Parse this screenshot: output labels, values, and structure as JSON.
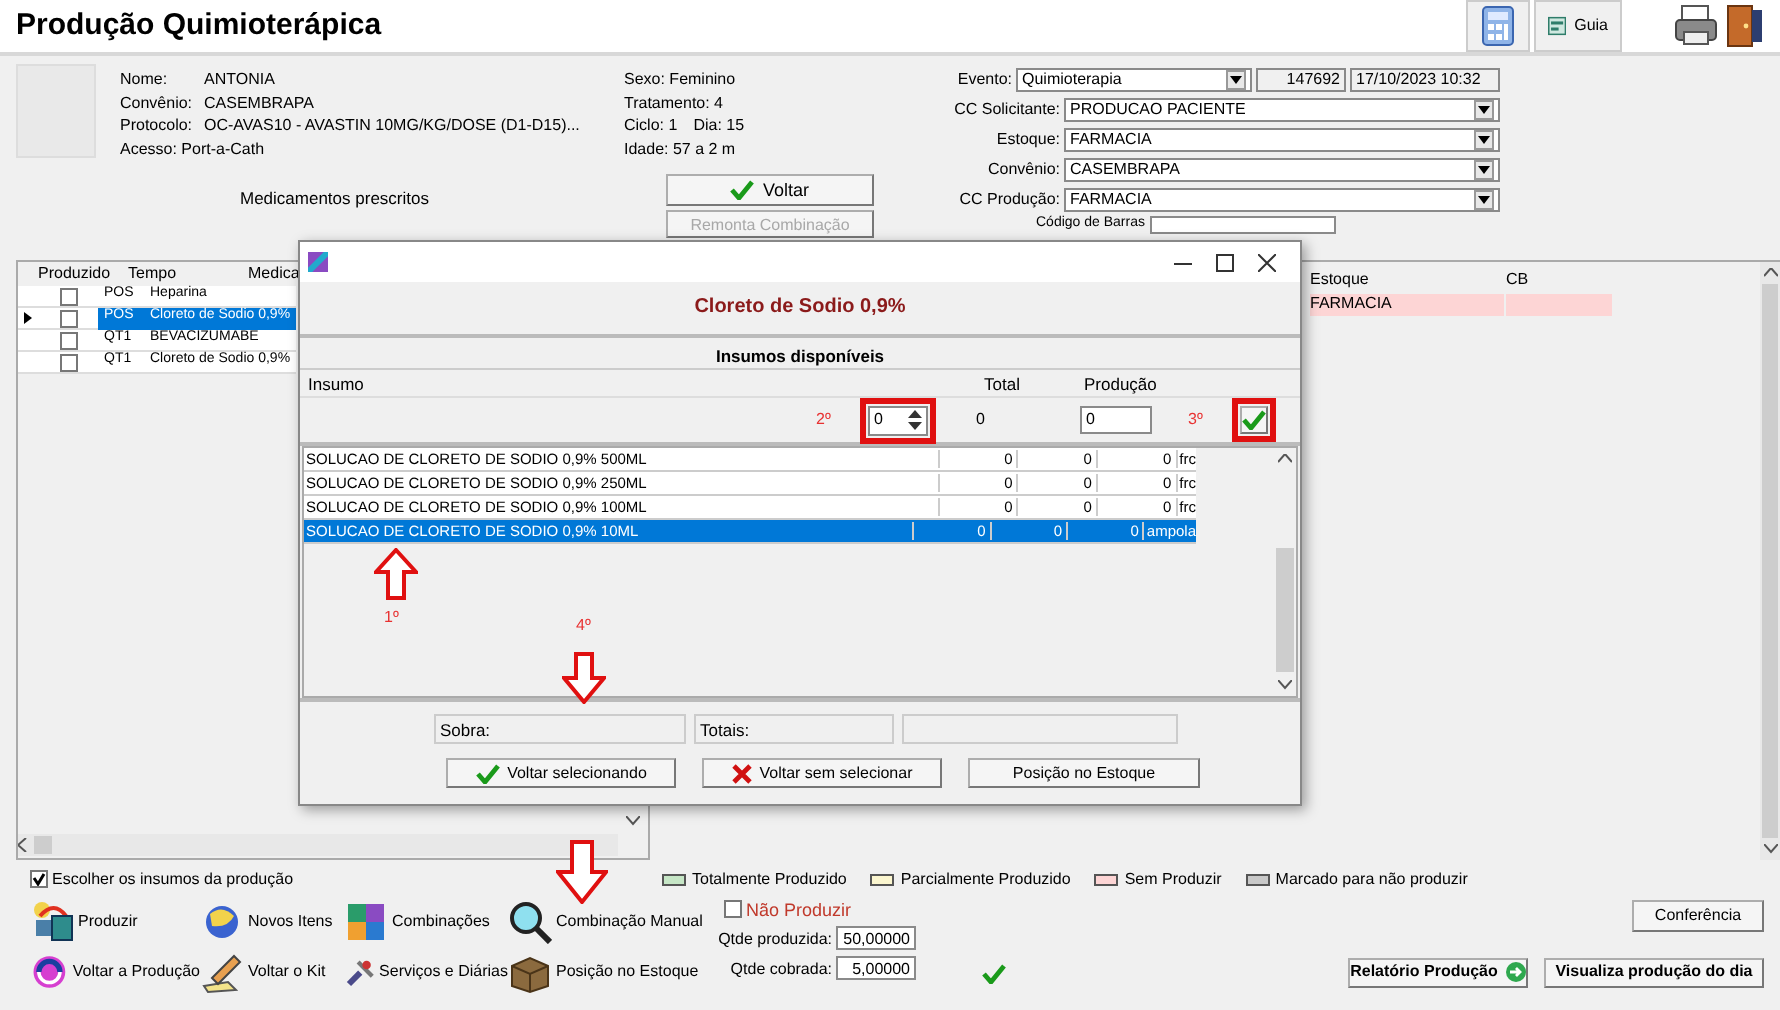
{
  "window": {
    "title": "Produção Quimioterápica",
    "guide_button": "Guia"
  },
  "patient": {
    "fields": [
      {
        "label": "Nome:",
        "value": "ANTONIA"
      },
      {
        "label": "Convênio:",
        "value": "CASEMBRAPA"
      },
      {
        "label": "Protocolo:",
        "value": "OC-AVAS10 - AVASTIN 10MG/KG/DOSE (D1-D15)..."
      }
    ],
    "access": "Acesso: Port-a-Cath",
    "details": [
      [
        "Sexo: Feminino"
      ],
      [
        "Tratamento: 4"
      ],
      [
        "Ciclo: 1",
        "Dia: 15"
      ],
      [
        "Idade: 57 a 2 m"
      ]
    ]
  },
  "event": {
    "label": "Evento:",
    "value": "Quimioterapia",
    "number": "147692",
    "datetime": "17/10/2023 10:32"
  },
  "selects": [
    {
      "label": "CC Solicitante:",
      "value": "PRODUCAO PACIENTE"
    },
    {
      "label": "Estoque:",
      "value": "FARMACIA"
    },
    {
      "label": "Convênio:",
      "value": "CASEMBRAPA"
    },
    {
      "label": "CC Produção:",
      "value": "FARMACIA"
    }
  ],
  "barcode_label": "Código de Barras",
  "prescribed_title": "Medicamentos prescritos",
  "back_button": "Voltar",
  "remount_button": {
    "label": "Remonta Combinação",
    "disabled": true
  },
  "meds_table": {
    "columns": [
      "Produzido",
      "Tempo",
      "Medica"
    ],
    "rows": [
      {
        "checked": false,
        "selected": false,
        "time": "POS",
        "name": "Heparina"
      },
      {
        "checked": false,
        "selected": true,
        "time": "POS",
        "name": "Cloreto de Sodio 0,9%"
      },
      {
        "checked": false,
        "selected": false,
        "time": "QT1",
        "name": "BEVACIZUMABE"
      },
      {
        "checked": false,
        "selected": false,
        "time": "QT1",
        "name": "Cloreto de Sodio 0,9%"
      }
    ]
  },
  "stock_table": {
    "columns": [
      "Estoque",
      "CB"
    ],
    "rows": [
      {
        "stock": "FARMACIA",
        "color": "#fdd5d5"
      }
    ]
  },
  "dialog": {
    "drug": "Cloreto de Sodio 0,9%",
    "section_title": "Insumos disponíveis",
    "columns": [
      "Insumo",
      "Total",
      "Produção"
    ],
    "quantity": "0",
    "total": "0",
    "production": "0",
    "items": [
      {
        "name": "SOLUCAO DE CLORETO DE SODIO 0,9% 500ML",
        "values": [
          "0",
          "0",
          "0"
        ],
        "unit": "frc",
        "selected": false
      },
      {
        "name": "SOLUCAO DE CLORETO DE SODIO 0,9% 250ML",
        "values": [
          "0",
          "0",
          "0"
        ],
        "unit": "frc",
        "selected": false
      },
      {
        "name": "SOLUCAO DE CLORETO DE SODIO 0,9% 100ML",
        "values": [
          "0",
          "0",
          "0"
        ],
        "unit": "frc",
        "selected": false
      },
      {
        "name": "SOLUCAO DE CLORETO DE SODIO 0,9% 10ML",
        "values": [
          "0",
          "0",
          "0"
        ],
        "unit": "ampola",
        "selected": true
      }
    ],
    "sobra_label": "Sobra:",
    "totais_label": "Totais:",
    "buttons": [
      {
        "label": "Voltar selecionando",
        "kind": "confirm"
      },
      {
        "label": "Voltar sem selecionar",
        "kind": "cancel"
      },
      {
        "label": "Posição no Estoque",
        "kind": "plain"
      }
    ],
    "steps": [
      "1º",
      "2º",
      "3º",
      "4º"
    ]
  },
  "choose_inputs": {
    "label": "Escolher os insumos da produção",
    "checked": true
  },
  "legend": [
    {
      "label": "Totalmente Produzido",
      "color": "#c6e6c6"
    },
    {
      "label": "Parcialmente Produzido",
      "color": "#fbf6cf"
    },
    {
      "label": "Sem Produzir",
      "color": "#fdd5d5"
    },
    {
      "label": "Marcado para não produzir",
      "color": "#c8c8c8"
    }
  ],
  "actions": [
    {
      "label": "Produzir",
      "kind": "produce"
    },
    {
      "label": "Novos Itens",
      "kind": "globe"
    },
    {
      "label": "Combinações",
      "kind": "combine"
    },
    {
      "label": "Combinação Manual",
      "kind": "magnifier"
    },
    {
      "label": "Voltar a Produção",
      "kind": "cycle"
    },
    {
      "label": "Voltar o Kit",
      "kind": "pencil"
    },
    {
      "label": "Serviços e Diárias",
      "kind": "tools"
    },
    {
      "label": "Posição no Estoque",
      "kind": "box"
    }
  ],
  "no_produce": {
    "label": "Não Produzir",
    "checked": false
  },
  "quantities": [
    {
      "label": "Qtde produzida:",
      "value": "50,00000"
    },
    {
      "label": "Qtde cobrada:",
      "value": "5,00000"
    }
  ],
  "conference_button": "Conferência",
  "report_button": "Relatório Produção",
  "daily_button": "Visualiza produção do dia"
}
